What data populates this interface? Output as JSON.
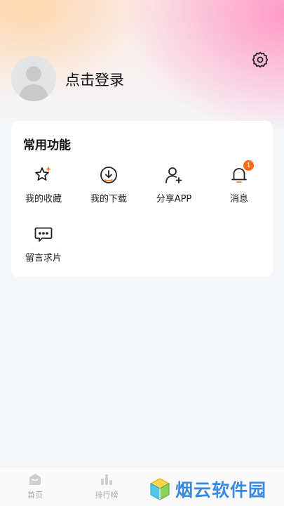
{
  "header": {
    "login_label": "点击登录"
  },
  "features": {
    "title": "常用功能",
    "items": [
      {
        "label": "我的收藏",
        "icon": "star-sparkle-icon"
      },
      {
        "label": "我的下载",
        "icon": "download-icon"
      },
      {
        "label": "分享APP",
        "icon": "add-user-icon"
      },
      {
        "label": "消息",
        "icon": "bell-icon",
        "badge": "1"
      },
      {
        "label": "留言求片",
        "icon": "message-dots-icon"
      }
    ]
  },
  "tabbar": {
    "tabs": [
      {
        "label": "首页",
        "icon": "home-icon"
      },
      {
        "label": "排行榜",
        "icon": "ranking-icon"
      }
    ]
  },
  "watermark": {
    "text": "烟云软件园"
  },
  "colors": {
    "badge": "#ff6a1a",
    "watermark": "#3a8be0",
    "icon_accent": "#ff7a1a"
  }
}
